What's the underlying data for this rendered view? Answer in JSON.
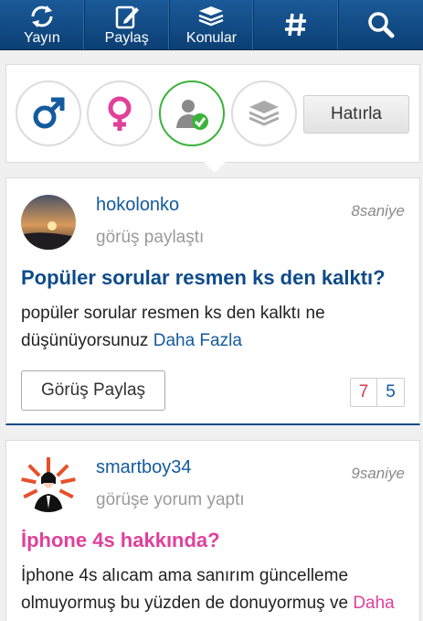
{
  "nav": {
    "items": [
      {
        "label": "Yayın",
        "icon": "refresh-icon"
      },
      {
        "label": "Paylaş",
        "icon": "edit-icon"
      },
      {
        "label": "Konular",
        "icon": "stack-icon"
      },
      {
        "label": "",
        "icon": "hashtag-icon"
      },
      {
        "label": "",
        "icon": "search-icon"
      }
    ]
  },
  "filters": {
    "icons": [
      "male-icon",
      "female-icon",
      "user-check-icon",
      "stack-icon"
    ],
    "remember_label": "Hatırla",
    "colors": {
      "male": "#135a9e",
      "female": "#e0409a",
      "active_border": "#3bb33b"
    }
  },
  "posts": [
    {
      "username": "hokolonko",
      "action": "görüş paylaştı",
      "time": "8saniye",
      "title": "Popüler sorular resmen ks den kalktı?",
      "body": "popüler sorular resmen ks den kalktı ne düşünüyorsunuz ",
      "more": "Daha Fazla",
      "button_label": "Görüş Paylaş",
      "count_red": "7",
      "count_blue": "5"
    },
    {
      "username": "smartboy34",
      "action": "görüşe yorum yaptı",
      "time": "9saniye",
      "title": "İphone 4s hakkında?",
      "body": "İphone 4s alıcam ama sanırım güncelleme olmuyormuş bu yüzden de donuyormuş ve ",
      "more": "Daha"
    }
  ]
}
